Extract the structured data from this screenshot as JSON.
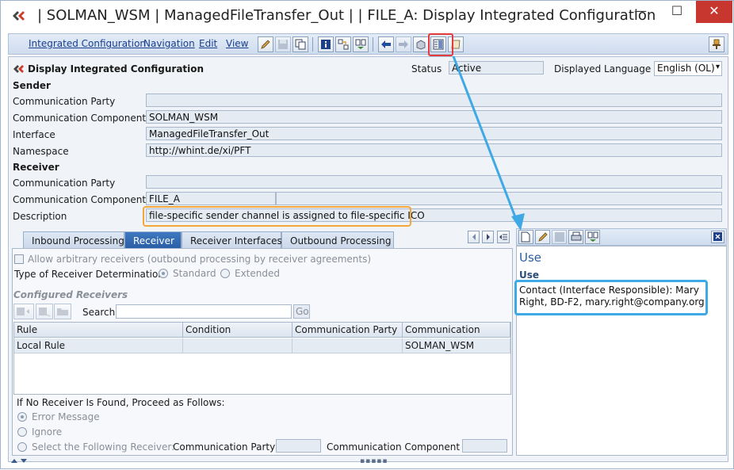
{
  "window": {
    "title": "| SOLMAN_WSM | ManagedFileTransfer_Out |  | FILE_A: Display Integrated Configuration",
    "minimize_glyph": "—",
    "maximize_glyph": "☐",
    "close_glyph": "✕"
  },
  "menu": {
    "items": [
      "Integrated Configuration",
      "Navigation",
      "Edit",
      "View"
    ]
  },
  "header": {
    "title": "Display Integrated Configuration",
    "status_label": "Status",
    "status_value": "Active",
    "language_label": "Displayed Language",
    "language_value": "English (OL)"
  },
  "sender": {
    "heading": "Sender",
    "party_label": "Communication Party",
    "party_value": "",
    "component_label": "Communication Component",
    "component_value": "SOLMAN_WSM",
    "interface_label": "Interface",
    "interface_value": "ManagedFileTransfer_Out",
    "namespace_label": "Namespace",
    "namespace_value": "http://whint.de/xi/PFT"
  },
  "receiver": {
    "heading": "Receiver",
    "party_label": "Communication Party",
    "party_value": "",
    "component_label": "Communication Component",
    "component_value": "FILE_A",
    "description_label": "Description",
    "description_value": "file-specific sender channel is assigned to file-specific ICO"
  },
  "tabs": [
    "Inbound Processing",
    "Receiver",
    "Receiver Interfaces",
    "Outbound Processing"
  ],
  "active_tab": "Receiver",
  "receiver_tab": {
    "allow_arbitrary_label": "Allow arbitrary receivers (outbound processing by receiver agreements)",
    "type_label": "Type of Receiver Determination",
    "type_standard": "Standard",
    "type_extended": "Extended",
    "configured_heading": "Configured Receivers",
    "search_label": "Search",
    "search_value": "",
    "go_label": "Go",
    "table": {
      "headers": [
        "Rule",
        "Condition",
        "Communication Party",
        "Communication"
      ],
      "rows": [
        [
          "Local Rule",
          "",
          "",
          "SOLMAN_WSM"
        ]
      ]
    },
    "no_receiver_label": "If No Receiver Is Found, Proceed as Follows:",
    "options": [
      "Error Message",
      "Ignore",
      "Select the Following Receiver:"
    ],
    "party_label": "Communication Party",
    "component_label": "Communication Component"
  },
  "use_panel": {
    "title": "Use",
    "subheading": "Use",
    "body": "Contact (Interface Responsible): Mary Right, BD-F2, mary.right@company.org"
  },
  "colors": {
    "accent_blue": "#2a5ea6",
    "callout_blue": "#3fa9e6",
    "callout_orange": "#f3a73a",
    "callout_red": "#e23b3b"
  }
}
